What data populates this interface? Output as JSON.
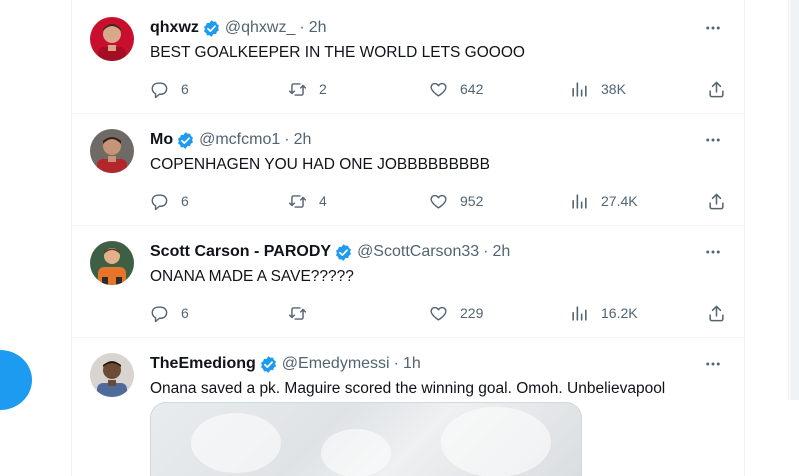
{
  "tweets": [
    {
      "name": "qhxwz",
      "handle": "@qhxwz_",
      "separator": "·",
      "time": "2h",
      "text": "BEST GOALKEEPER IN THE WORLD LETS GOOOO",
      "replies": "6",
      "retweets": "2",
      "likes": "642",
      "views": "38K",
      "avatar_color": "#c8102e"
    },
    {
      "name": "Mo",
      "handle": "@mcfcmo1",
      "separator": "·",
      "time": "2h",
      "text": "COPENHAGEN YOU HAD ONE JOBBBBBBBBB",
      "replies": "6",
      "retweets": "4",
      "likes": "952",
      "views": "27.4K",
      "avatar_color": "#b3262b"
    },
    {
      "name": "Scott Carson - PARODY",
      "handle": "@ScottCarson33",
      "separator": "·",
      "time": "2h",
      "text": "ONANA MADE A SAVE?????",
      "replies": "6",
      "retweets": "",
      "likes": "229",
      "views": "16.2K",
      "avatar_color": "#e8742a"
    },
    {
      "name": "TheEmediong",
      "handle": "@Emedymessi",
      "separator": "·",
      "time": "1h",
      "text": "Onana saved a pk. Maguire scored the winning goal. Omoh. Unbelievapool",
      "avatar_color": "#6b5444"
    }
  ],
  "colors": {
    "accent": "#1d9bf0",
    "text_primary": "#0f1419",
    "text_secondary": "#536471",
    "divider": "#eff3f4"
  },
  "icons": {
    "verified": "verified-badge-icon",
    "more": "more-horizontal-icon",
    "reply": "reply-icon",
    "retweet": "retweet-icon",
    "like": "heart-icon",
    "views": "views-chart-icon",
    "share": "share-icon"
  }
}
